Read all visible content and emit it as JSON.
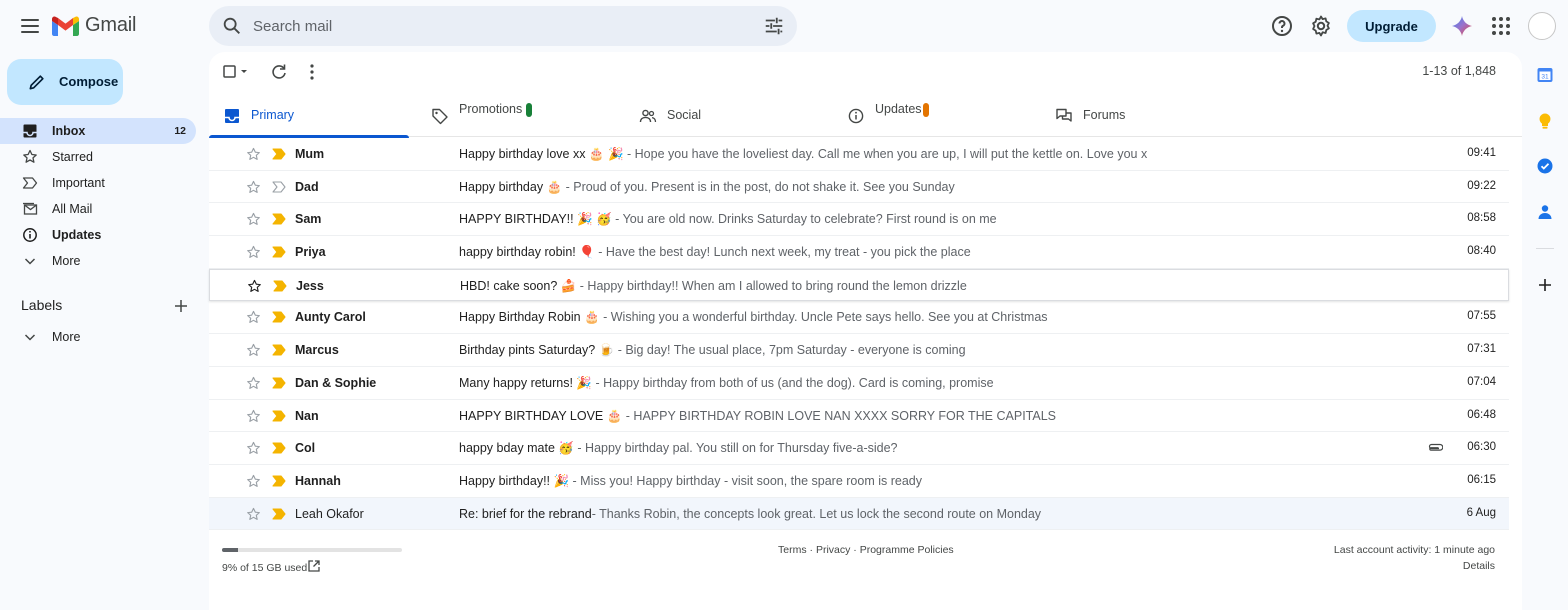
{
  "app": {
    "name": "Gmail"
  },
  "search": {
    "placeholder": "Search mail"
  },
  "header": {
    "upgrade_label": "Upgrade"
  },
  "compose": {
    "label": "Compose"
  },
  "sidebar": {
    "items": [
      {
        "label": "Inbox",
        "count": "12",
        "icon": "inbox-icon"
      },
      {
        "label": "Starred",
        "count": "",
        "icon": "star-icon"
      },
      {
        "label": "Important",
        "count": "",
        "icon": "important-icon"
      },
      {
        "label": "All Mail",
        "count": "",
        "icon": "all-mail-icon"
      },
      {
        "label": "Updates",
        "count": "",
        "icon": "info-icon"
      },
      {
        "label": "More",
        "count": "",
        "icon": "chevron-down-icon"
      }
    ],
    "labels_title": "Labels",
    "labels_more": "More"
  },
  "toolbar": {
    "count": "1-13 of 1,848"
  },
  "tabs": [
    {
      "label": "Primary",
      "icon": "inbox-icon"
    },
    {
      "label": "Promotions",
      "icon": "tag-icon",
      "badge_color": "#188038"
    },
    {
      "label": "Social",
      "icon": "people-icon"
    },
    {
      "label": "Updates",
      "icon": "info-icon",
      "badge_color": "#e37400"
    },
    {
      "label": "Forums",
      "icon": "forum-icon"
    }
  ],
  "emails": [
    {
      "sender": "Mum",
      "subject": "Happy birthday love xx 🎂 🎉",
      "snippet": " - Hope you have the loveliest day. Call me when you are up, I will put the kettle on. Love you x",
      "time": "09:41",
      "important": true,
      "read": false,
      "attachment": false
    },
    {
      "sender": "Dad",
      "subject": "Happy birthday 🎂",
      "snippet": " - Proud of you. Present is in the post, do not shake it. See you Sunday",
      "time": "09:22",
      "important": false,
      "read": false,
      "attachment": false
    },
    {
      "sender": "Sam",
      "subject": "HAPPY BIRTHDAY!! 🎉 🥳",
      "snippet": " - You are old now. Drinks Saturday to celebrate? First round is on me",
      "time": "08:58",
      "important": true,
      "read": false,
      "attachment": false
    },
    {
      "sender": "Priya",
      "subject": "happy birthday robin! 🎈",
      "snippet": " - Have the best day! Lunch next week, my treat - you pick the place",
      "time": "08:40",
      "important": true,
      "read": false,
      "attachment": false
    },
    {
      "sender": "Jess",
      "subject": "HBD! cake soon? 🍰",
      "snippet": " - Happy birthday!! When am I allowed to bring round the lemon drizzle",
      "time": "",
      "important": true,
      "read": false,
      "attachment": false
    },
    {
      "sender": "Aunty Carol",
      "subject": "Happy Birthday Robin 🎂",
      "snippet": " - Wishing you a wonderful birthday. Uncle Pete says hello. See you at Christmas",
      "time": "07:55",
      "important": true,
      "read": false,
      "attachment": false
    },
    {
      "sender": "Marcus",
      "subject": "Birthday pints Saturday? 🍺",
      "snippet": " - Big day! The usual place, 7pm Saturday - everyone is coming",
      "time": "07:31",
      "important": true,
      "read": false,
      "attachment": false
    },
    {
      "sender": "Dan & Sophie",
      "subject": "Many happy returns! 🎉",
      "snippet": " - Happy birthday from both of us (and the dog). Card is coming, promise",
      "time": "07:04",
      "important": true,
      "read": false,
      "attachment": false
    },
    {
      "sender": "Nan",
      "subject": "HAPPY BIRTHDAY LOVE 🎂",
      "snippet": " - HAPPY BIRTHDAY ROBIN LOVE NAN XXXX SORRY FOR THE CAPITALS",
      "time": "06:48",
      "important": true,
      "read": false,
      "attachment": false
    },
    {
      "sender": "Col",
      "subject": "happy bday mate 🥳",
      "snippet": " - Happy birthday pal. You still on for Thursday five-a-side?",
      "time": "06:30",
      "important": true,
      "read": false,
      "attachment": true
    },
    {
      "sender": "Hannah",
      "subject": "Happy birthday!! 🎉",
      "snippet": " - Miss you! Happy birthday - visit soon, the spare room is ready",
      "time": "06:15",
      "important": true,
      "read": false,
      "attachment": false
    },
    {
      "sender": "Leah Okafor",
      "subject": "Re: brief for the rebrand",
      "snippet": "- Thanks Robin, the concepts look great. Let us lock the second route on Monday",
      "time": "6 Aug",
      "important": true,
      "read": true,
      "attachment": false
    }
  ],
  "footer": {
    "storage_text": "9% of 15 GB used",
    "storage_percent": 9,
    "terms": "Terms",
    "privacy": "Privacy",
    "policies": "Programme Policies",
    "separator": " · ",
    "activity": "Last account activity: 1 minute ago",
    "details": "Details"
  },
  "colors": {
    "accent": "#0b57d0",
    "compose_bg": "#c2e7ff",
    "important": "#f4b400"
  }
}
